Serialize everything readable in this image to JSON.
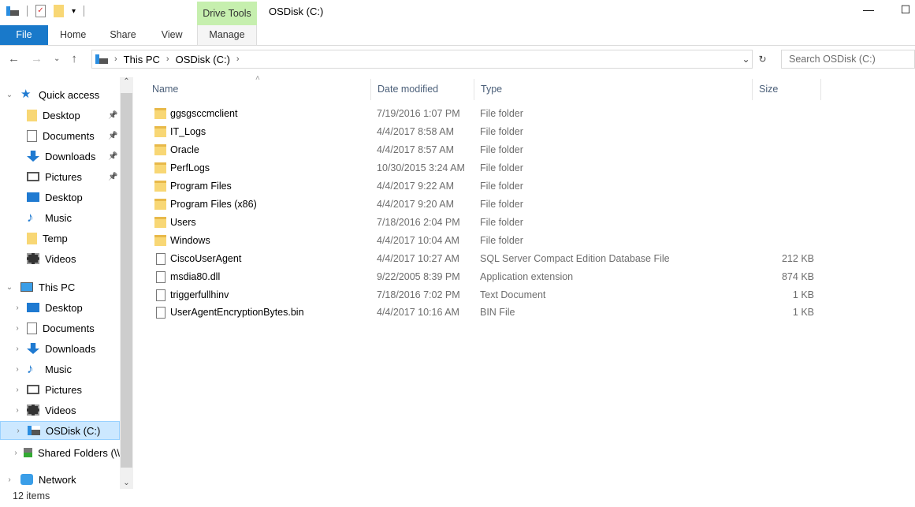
{
  "window": {
    "title": "OSDisk (C:)",
    "context_tab": "Drive Tools",
    "context_subtab": "Manage"
  },
  "ribbon": {
    "tabs": [
      "File",
      "Home",
      "Share",
      "View"
    ]
  },
  "address": {
    "crumbs": [
      "This PC",
      "OSDisk (C:)"
    ],
    "search_placeholder": "Search OSDisk (C:)"
  },
  "nav": [
    {
      "label": "Quick access",
      "icon": "star-icon",
      "level": 0,
      "expanded": true
    },
    {
      "label": "Desktop",
      "icon": "folder-icon",
      "level": 1,
      "pinned": true
    },
    {
      "label": "Documents",
      "icon": "documents-icon",
      "level": 1,
      "pinned": true
    },
    {
      "label": "Downloads",
      "icon": "download-icon",
      "level": 1,
      "pinned": true
    },
    {
      "label": "Pictures",
      "icon": "pictures-icon",
      "level": 1,
      "pinned": true
    },
    {
      "label": "Desktop",
      "icon": "desktop-icon",
      "level": 1
    },
    {
      "label": "Music",
      "icon": "music-icon",
      "level": 1
    },
    {
      "label": "Temp",
      "icon": "folder-icon",
      "level": 1
    },
    {
      "label": "Videos",
      "icon": "videos-icon",
      "level": 1
    },
    {
      "label": "This PC",
      "icon": "computer-icon",
      "level": 0,
      "expanded": true
    },
    {
      "label": "Desktop",
      "icon": "desktop-icon",
      "level": 1,
      "collapsed": true
    },
    {
      "label": "Documents",
      "icon": "documents-icon",
      "level": 1,
      "collapsed": true
    },
    {
      "label": "Downloads",
      "icon": "download-icon",
      "level": 1,
      "collapsed": true
    },
    {
      "label": "Music",
      "icon": "music-icon",
      "level": 1,
      "collapsed": true
    },
    {
      "label": "Pictures",
      "icon": "pictures-icon",
      "level": 1,
      "collapsed": true
    },
    {
      "label": "Videos",
      "icon": "videos-icon",
      "level": 1,
      "collapsed": true
    },
    {
      "label": "OSDisk (C:)",
      "icon": "drive-icon",
      "level": 1,
      "collapsed": true,
      "selected": true
    },
    {
      "label": "Shared Folders (\\\\",
      "icon": "network-drive-icon",
      "level": 1,
      "collapsed": true
    },
    {
      "label": "Network",
      "icon": "network-icon",
      "level": 0,
      "collapsed": true
    }
  ],
  "columns": [
    "Name",
    "Date modified",
    "Type",
    "Size"
  ],
  "files": [
    {
      "name": "ggsgsccmclient",
      "date": "7/19/2016 1:07 PM",
      "type": "File folder",
      "size": "",
      "icon": "folder"
    },
    {
      "name": "IT_Logs",
      "date": "4/4/2017 8:58 AM",
      "type": "File folder",
      "size": "",
      "icon": "folder"
    },
    {
      "name": "Oracle",
      "date": "4/4/2017 8:57 AM",
      "type": "File folder",
      "size": "",
      "icon": "folder"
    },
    {
      "name": "PerfLogs",
      "date": "10/30/2015 3:24 AM",
      "type": "File folder",
      "size": "",
      "icon": "folder"
    },
    {
      "name": "Program Files",
      "date": "4/4/2017 9:22 AM",
      "type": "File folder",
      "size": "",
      "icon": "folder"
    },
    {
      "name": "Program Files (x86)",
      "date": "4/4/2017 9:20 AM",
      "type": "File folder",
      "size": "",
      "icon": "folder"
    },
    {
      "name": "Users",
      "date": "7/18/2016 2:04 PM",
      "type": "File folder",
      "size": "",
      "icon": "folder"
    },
    {
      "name": "Windows",
      "date": "4/4/2017 10:04 AM",
      "type": "File folder",
      "size": "",
      "icon": "folder"
    },
    {
      "name": "CiscoUserAgent",
      "date": "4/4/2017 10:27 AM",
      "type": "SQL Server Compact Edition Database File",
      "size": "212 KB",
      "icon": "file"
    },
    {
      "name": "msdia80.dll",
      "date": "9/22/2005 8:39 PM",
      "type": "Application extension",
      "size": "874 KB",
      "icon": "file"
    },
    {
      "name": "triggerfullhinv",
      "date": "7/18/2016 7:02 PM",
      "type": "Text Document",
      "size": "1 KB",
      "icon": "file"
    },
    {
      "name": "UserAgentEncryptionBytes.bin",
      "date": "4/4/2017 10:16 AM",
      "type": "BIN File",
      "size": "1 KB",
      "icon": "file"
    }
  ],
  "status": "12 items"
}
